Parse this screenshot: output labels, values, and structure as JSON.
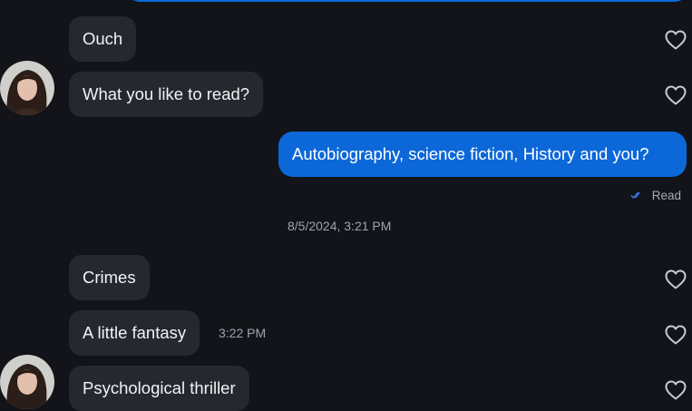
{
  "messages": [
    {
      "id": "m1",
      "side": "received",
      "text": "Ouch"
    },
    {
      "id": "m2",
      "side": "received",
      "text": "What you like to read?"
    },
    {
      "id": "m3",
      "side": "sent",
      "text": "Autobiography, science fiction, History and you?"
    },
    {
      "id": "m4",
      "side": "received",
      "text": "Crimes"
    },
    {
      "id": "m5",
      "side": "received",
      "text": "A little fantasy",
      "time": "3:22 PM"
    },
    {
      "id": "m6",
      "side": "received",
      "text": "Psychological thriller"
    }
  ],
  "read_receipt": {
    "label": "Read",
    "icon": "double-check-icon"
  },
  "date_separator": "8/5/2024, 3:21 PM",
  "colors": {
    "background": "#121419",
    "received_bubble": "#25282f",
    "sent_bubble": "#0c68d9",
    "read_check": "#3b82f6"
  }
}
